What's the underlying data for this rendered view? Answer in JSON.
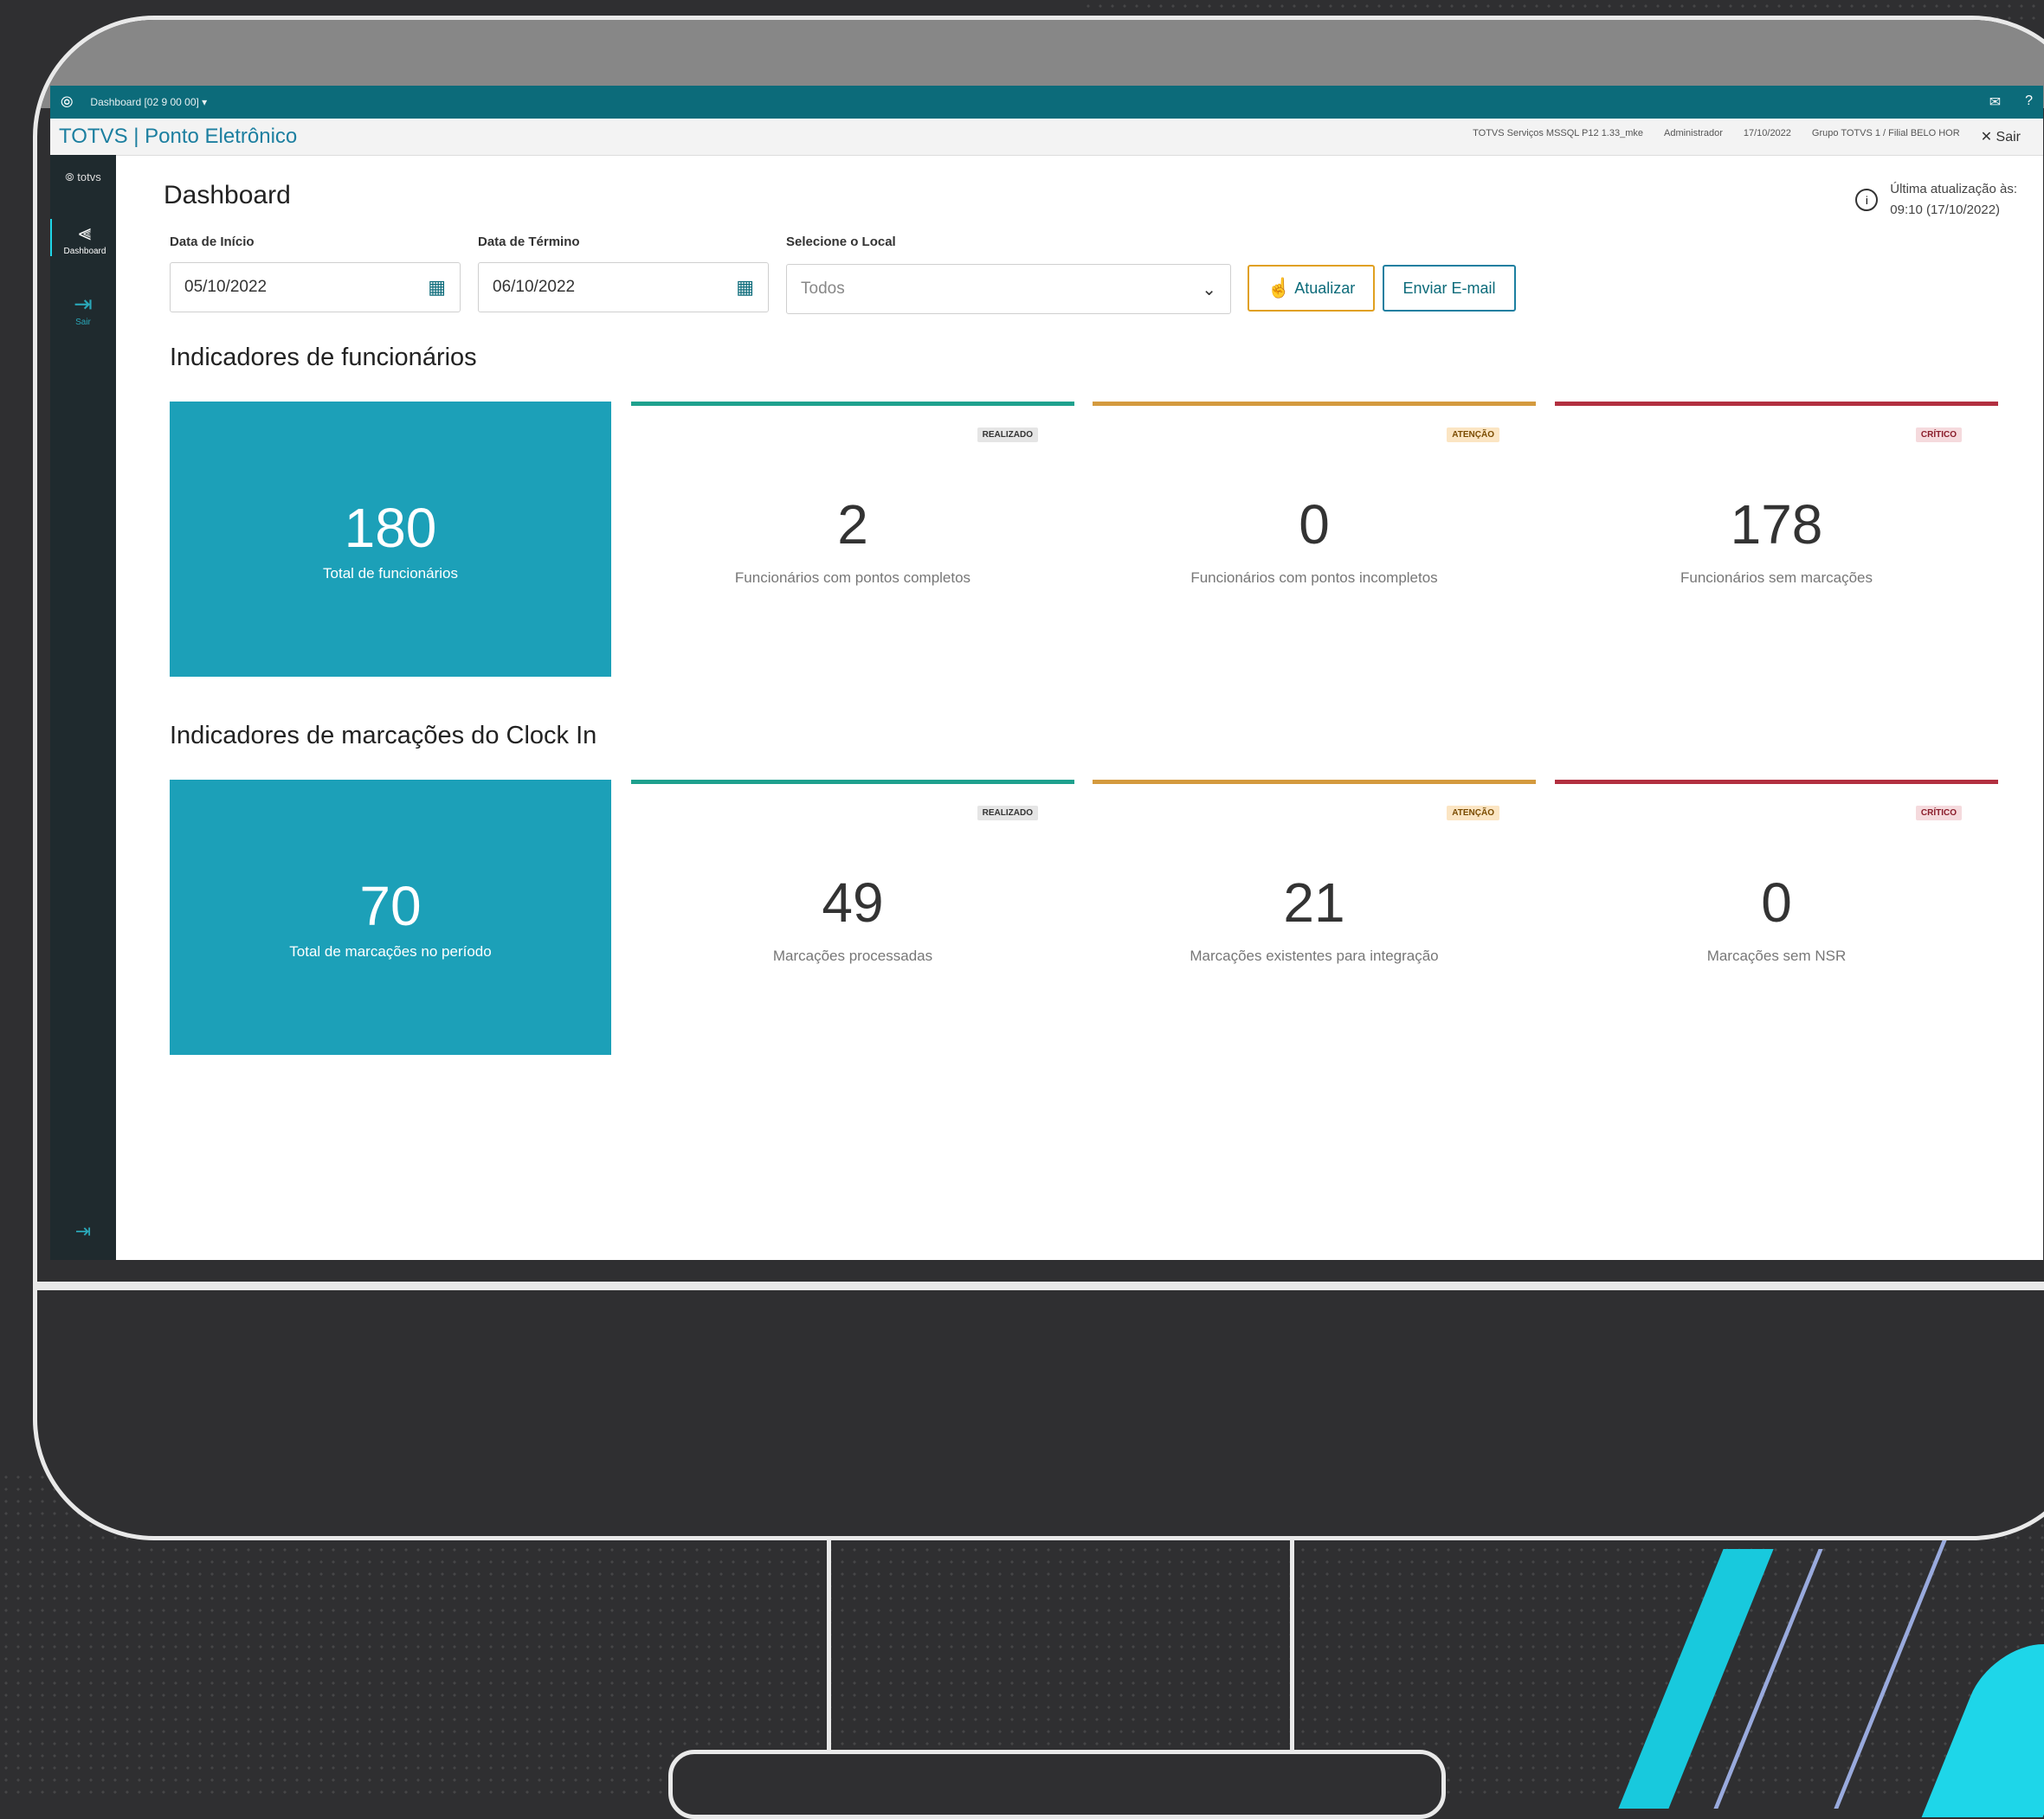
{
  "window": {
    "tab_label": "Dashboard [02 9 00 00] ▾",
    "app_title": "TOTVS | Ponto Eletrônico",
    "meta": [
      "TOTVS Serviços MSSQL P12 1.33_mke",
      "Administrador",
      "17/10/2022",
      "Grupo TOTVS 1 / Filial BELO HOR"
    ],
    "close_label": "✕ Sair"
  },
  "sidebar": {
    "brand": "⦾ totvs",
    "items": [
      {
        "label": "Dashboard",
        "icon": "chart-icon"
      },
      {
        "label": "Sair",
        "icon": "logout-icon"
      }
    ]
  },
  "header": {
    "title": "Dashboard",
    "last_update_label": "Última atualização às:",
    "last_update_value": "09:10 (17/10/2022)"
  },
  "filters": {
    "start_label": "Data de Início",
    "start_value": "05/10/2022",
    "end_label": "Data de Término",
    "end_value": "06/10/2022",
    "local_label": "Selecione o Local",
    "local_value": "Todos",
    "update_button": "Atualizar",
    "email_button": "Enviar E-mail"
  },
  "employees": {
    "title": "Indicadores de funcionários",
    "total": {
      "value": "180",
      "label": "Total de funcionários"
    },
    "cards": [
      {
        "badge": "REALIZADO",
        "value": "2",
        "label": "Funcionários com pontos completos",
        "status": "green"
      },
      {
        "badge": "ATENÇÃO",
        "value": "0",
        "label": "Funcionários com pontos incompletos",
        "status": "orange"
      },
      {
        "badge": "CRÍTICO",
        "value": "178",
        "label": "Funcionários sem marcações",
        "status": "red"
      }
    ]
  },
  "clockin": {
    "title": "Indicadores de marcações do Clock In",
    "total": {
      "value": "70",
      "label": "Total de marcações no período"
    },
    "cards": [
      {
        "badge": "REALIZADO",
        "value": "49",
        "label": "Marcações processadas",
        "status": "green"
      },
      {
        "badge": "ATENÇÃO",
        "value": "21",
        "label": "Marcações existentes para integração",
        "status": "orange"
      },
      {
        "badge": "CRÍTICO",
        "value": "0",
        "label": "Marcações sem NSR",
        "status": "red"
      }
    ]
  },
  "colors": {
    "accent": "#1ca0b8",
    "topbar": "#0c6b7a",
    "success": "#1ea18e",
    "warning": "#d49a3e",
    "critical": "#b23040"
  }
}
